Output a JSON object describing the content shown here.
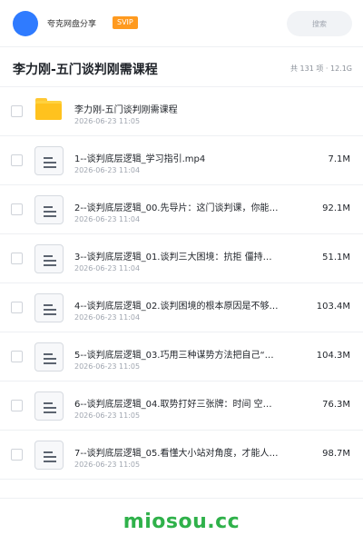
{
  "header": {
    "share_name": "夸克网盘分享",
    "badge": "SVIP",
    "search_label": "搜索"
  },
  "folder": {
    "title": "李力刚-五门谈判刚需课程",
    "summary": "共 131 项 · 12.1G"
  },
  "items": [
    {
      "type": "folder",
      "icon": "folder-icon",
      "name": "李力刚-五门谈判刚需课程",
      "date": "2026-06-23 11:05",
      "size": ""
    },
    {
      "type": "file",
      "icon": "document-icon",
      "name": "1--谈判底层逻辑_学习指引.mp4",
      "date": "2026-06-23 11:04",
      "size": "7.1M"
    },
    {
      "type": "file",
      "icon": "document-icon",
      "name": "2--谈判底层逻辑_00.先导片：这门谈判课，你能…",
      "date": "2026-06-23 11:04",
      "size": "92.1M"
    },
    {
      "type": "file",
      "icon": "document-icon",
      "name": "3--谈判底层逻辑_01.谈判三大困境：抗拒 僵持…",
      "date": "2026-06-23 11:04",
      "size": "51.1M"
    },
    {
      "type": "file",
      "icon": "document-icon",
      "name": "4--谈判底层逻辑_02.谈判困境的根本原因是不够…",
      "date": "2026-06-23 11:04",
      "size": "103.4M"
    },
    {
      "type": "file",
      "icon": "document-icon",
      "name": "5--谈判底层逻辑_03.巧用三种谋势方法把自己“…",
      "date": "2026-06-23 11:05",
      "size": "104.3M"
    },
    {
      "type": "file",
      "icon": "document-icon",
      "name": "6--谈判底层逻辑_04.取势打好三张牌：时间 空…",
      "date": "2026-06-23 11:05",
      "size": "76.3M"
    },
    {
      "type": "file",
      "icon": "document-icon",
      "name": "7--谈判底层逻辑_05.看懂大小站对角度，才能人…",
      "date": "2026-06-23 11:05",
      "size": "98.7M"
    }
  ],
  "watermark": "miosou.cc",
  "colors": {
    "accent": "#2f7bff",
    "badge": "#ff9a1f",
    "folder": "#ffd23f",
    "watermark": "#2fb14a"
  }
}
